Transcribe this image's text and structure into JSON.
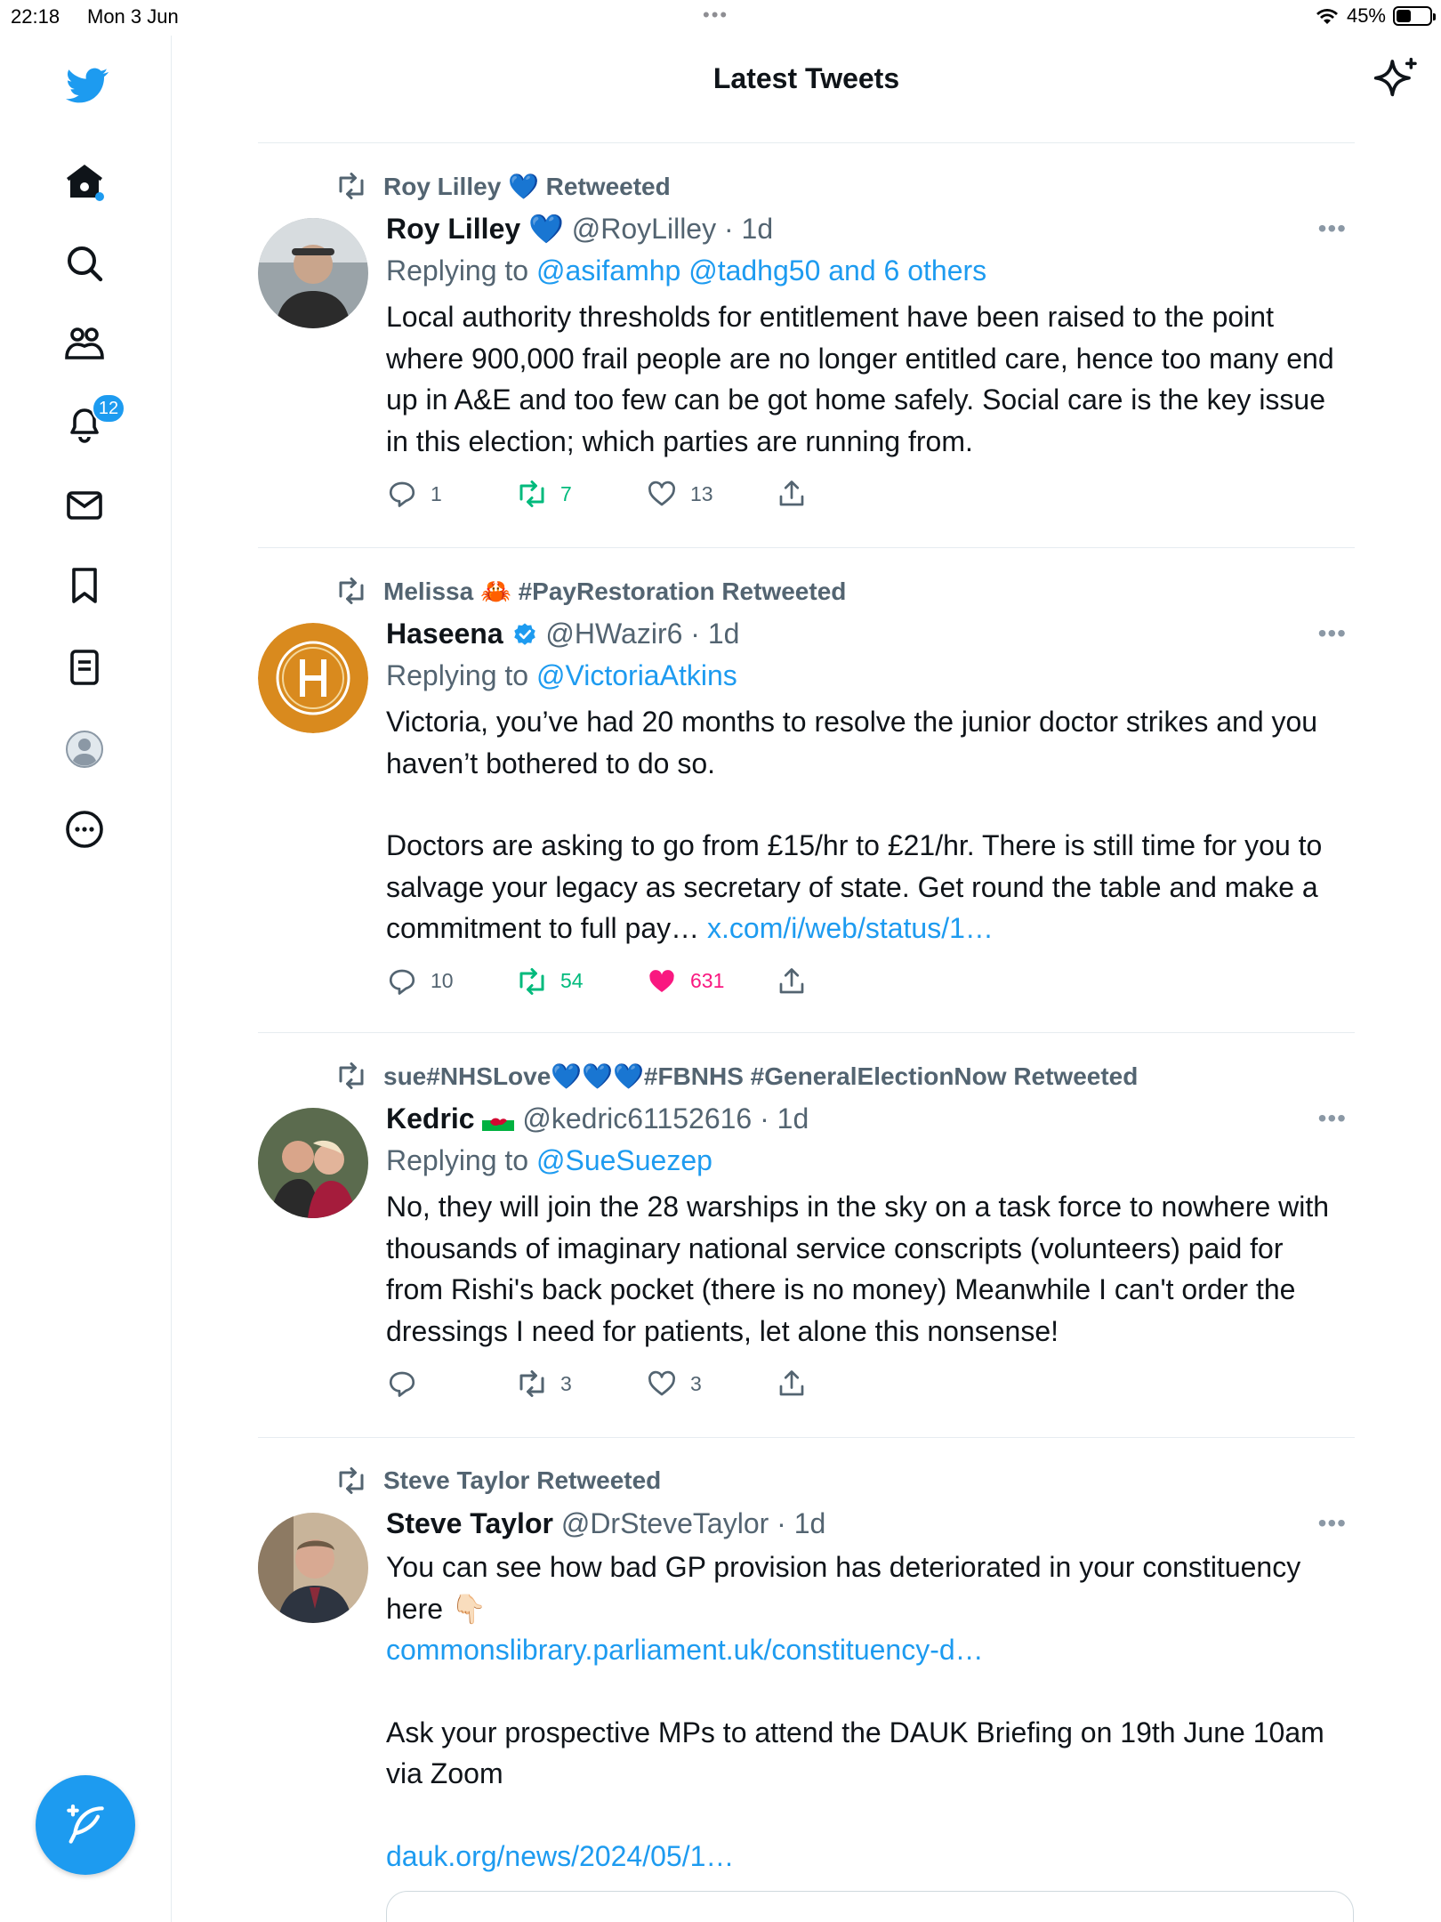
{
  "status_bar": {
    "time": "22:18",
    "date": "Mon 3 Jun",
    "battery": "45%"
  },
  "header": {
    "title": "Latest Tweets"
  },
  "sidebar": {
    "notifications_badge": "12",
    "items": [
      "home-icon",
      "search-icon",
      "communities-icon",
      "notifications-icon",
      "messages-icon",
      "bookmarks-icon",
      "lists-icon",
      "profile-icon",
      "more-icon"
    ]
  },
  "tweets": [
    {
      "retweeted_by": "Roy Lilley 💙 Retweeted",
      "name": "Roy Lilley 💙",
      "handle": "@RoyLilley",
      "time": "· 1d",
      "replying_prefix": "Replying to ",
      "replying_to": "@asifamhp @tadhg50 and 6 others",
      "text": "Local authority thresholds for entitlement have been raised to the point where 900,000 frail people are no longer entitled care, hence too many end up in A&E and too few can be got home safely. Social care is the key issue in this election; which parties are running from.",
      "replies": "1",
      "retweets": "7",
      "likes": "13"
    },
    {
      "retweeted_by": "Melissa 🦀 #PayRestoration Retweeted",
      "name": "Haseena",
      "handle": "@HWazir6",
      "time": "· 1d",
      "replying_prefix": "Replying to ",
      "replying_to": "@VictoriaAtkins",
      "text_p1": "Victoria, you’ve had 20 months to resolve the junior doctor strikes and you haven’t bothered to do so.",
      "text_p2": "Doctors are asking to go from £15/hr to £21/hr. There is still time for you to salvage your legacy as secretary of state. Get round the table and make a commitment to full pay… ",
      "text_link": "x.com/i/web/status/1…",
      "replies": "10",
      "retweets": "54",
      "likes": "631"
    },
    {
      "retweeted_by": "sue#NHSLove💙💙💙#FBNHS #GeneralElectionNow Retweeted",
      "name": "Kedric",
      "handle": "@kedric61152616",
      "time": "· 1d",
      "replying_prefix": "Replying to ",
      "replying_to": "@SueSuezep",
      "text": "No, they will join the 28 warships in the sky on a task force to nowhere with thousands of imaginary national service conscripts (volunteers) paid for from Rishi's back pocket (there is no money) Meanwhile I can't order the dressings I need for patients, let alone this nonsense!",
      "replies": "",
      "retweets": "3",
      "likes": "3"
    },
    {
      "retweeted_by": "Steve Taylor Retweeted",
      "name": "Steve Taylor",
      "handle": "@DrSteveTaylor",
      "time": "· 1d",
      "text_p1": "You can see how bad GP provision has deteriorated in your constituency here 👇🏻",
      "link1": "commonslibrary.parliament.uk/constituency-d…",
      "text_p2": "Ask your prospective MPs to attend the DAUK Briefing on 19th June 10am via Zoom",
      "link2": "dauk.org/news/2024/05/1…"
    }
  ],
  "colors": {
    "accent": "#1d9bf0",
    "retweet_green": "#00ba7c",
    "like_pink": "#f91880",
    "secondary_text": "#536471"
  }
}
